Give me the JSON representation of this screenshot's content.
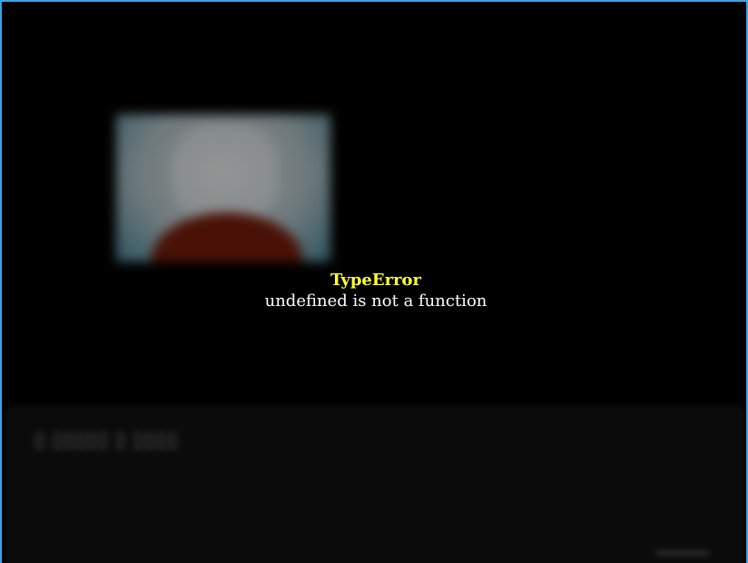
{
  "error": {
    "type": "TypeError",
    "message": "undefined is not a function"
  },
  "colors": {
    "window_border": "#3aa3e3",
    "background": "#000000",
    "error_type": "#ffff33",
    "error_message": "#ffffff",
    "panel": "#0b0b0b"
  }
}
